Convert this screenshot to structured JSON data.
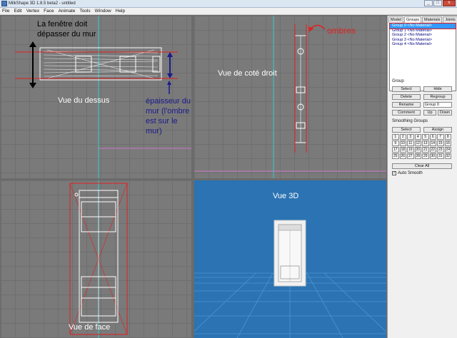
{
  "window": {
    "title": "MilkShape 3D 1.8.5 beta2 - untitled",
    "buttons": [
      "_",
      "□",
      "x"
    ]
  },
  "menu": [
    "File",
    "Edit",
    "Vertex",
    "Face",
    "Animate",
    "Tools",
    "Window",
    "Help"
  ],
  "viewports": {
    "top": {
      "label": "Vue du dessus",
      "note_black": [
        "La fenêtre doit",
        "dépasser du mur"
      ],
      "note_blue": [
        "épaisseur du",
        "mur (l'ombre",
        "est sur le",
        "mur)"
      ]
    },
    "right": {
      "label": "Vue de coté droit",
      "note_red": "ombres"
    },
    "front": {
      "label": "Vue de face"
    },
    "view3d": {
      "label": "Vue 3D"
    }
  },
  "panel": {
    "tabs": [
      "Model",
      "Groups",
      "Materials",
      "Joints"
    ],
    "active_tab": "Groups",
    "groups": [
      "Group 0 <No Material>",
      "Group 1 <No Material>",
      "Group 2 <No Material>",
      "Group 3 <No Material>",
      "Group 4 <No Material>"
    ],
    "group_section": "Group",
    "buttons": {
      "select": "Select",
      "hide": "Hide",
      "delete": "Delete",
      "regroup": "Regroup",
      "rename": "Rename",
      "comment": "Comment",
      "up": "Up",
      "down": "Down"
    },
    "group_name_value": "Group 0",
    "smoothing_section": "Smoothing Groups",
    "smoothing_buttons": {
      "select": "Select",
      "assign": "Assign",
      "clear_all": "Clear All"
    },
    "smoothing_numbers": [
      "1",
      "2",
      "3",
      "4",
      "5",
      "6",
      "7",
      "8",
      "9",
      "10",
      "11",
      "12",
      "13",
      "14",
      "15",
      "16",
      "17",
      "18",
      "19",
      "20",
      "21",
      "22",
      "23",
      "24",
      "25",
      "26",
      "27",
      "28",
      "29",
      "30",
      "31",
      "32"
    ],
    "auto_smooth_label": "Auto Smooth",
    "auto_smooth_checked": true
  },
  "colors": {
    "viewport_bg": "#7a7a7a",
    "view3d_bg": "#2b73b3",
    "annotation_red": "#e02020",
    "annotation_blue": "#1a1a8c",
    "selection": "#3399ff"
  }
}
